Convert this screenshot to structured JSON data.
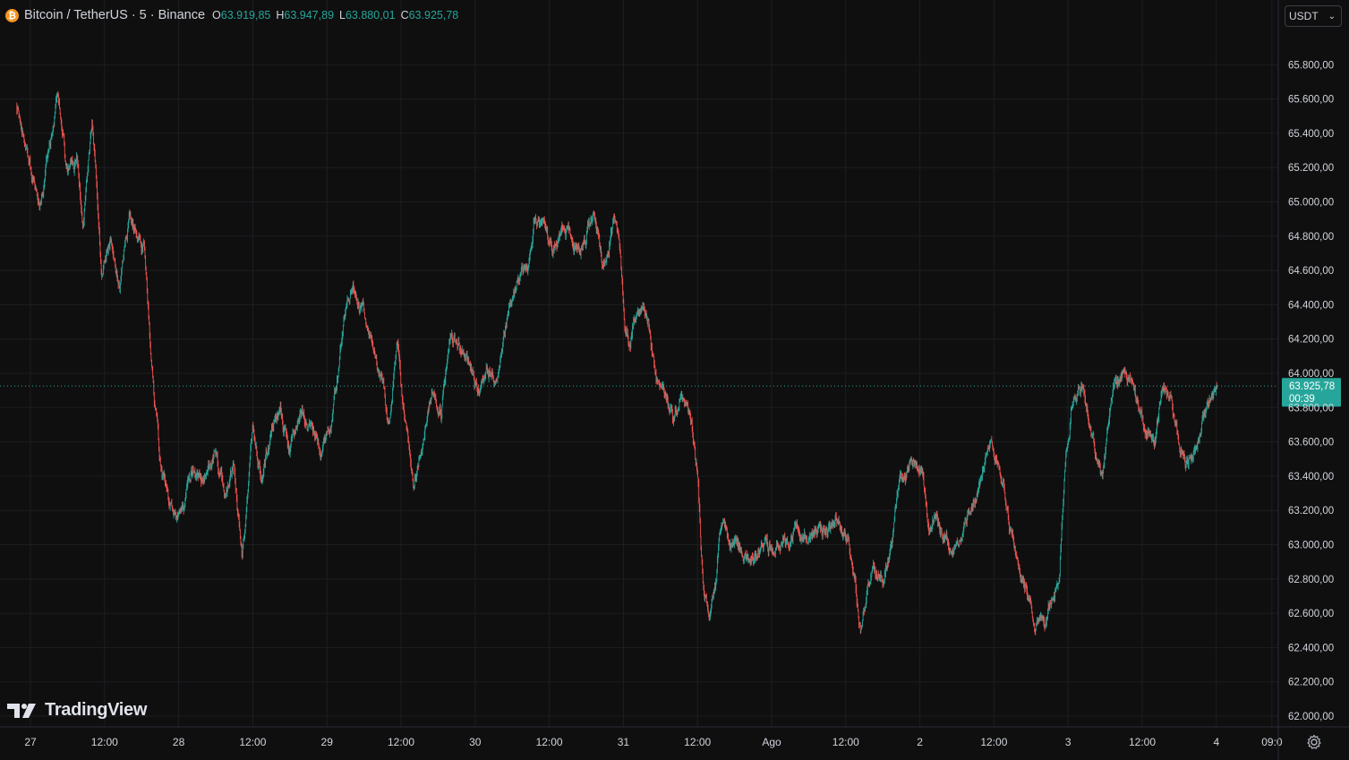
{
  "legend": {
    "symbol": "Bitcoin / TetherUS · 5 · Binance",
    "icon": "bitcoin-icon",
    "open_label": "O",
    "open_value": "63.919,85",
    "high_label": "H",
    "high_value": "63.947,89",
    "low_label": "L",
    "low_value": "63.880,01",
    "close_label": "C",
    "close_value": "63.925,78"
  },
  "currency": {
    "label": "USDT"
  },
  "branding": {
    "name": "TradingView"
  },
  "price_tag": {
    "price": "63.925,78",
    "countdown": "00:39"
  },
  "colors": {
    "background": "#0f0f0f",
    "up": "#26a69a",
    "down": "#ef5350",
    "grid": "#1c1e22",
    "axis_text": "#d1d4dc"
  },
  "chart_data": {
    "type": "candlestick",
    "timeframe": "5",
    "exchange": "Binance",
    "ylim": [
      62000,
      66000
    ],
    "y_ticks": [
      "62.000,00",
      "62.200,00",
      "62.400,00",
      "62.600,00",
      "62.800,00",
      "63.000,00",
      "63.200,00",
      "63.400,00",
      "63.600,00",
      "63.800,00",
      "64.000,00",
      "64.200,00",
      "64.400,00",
      "64.600,00",
      "64.800,00",
      "65.000,00",
      "65.200,00",
      "65.400,00",
      "65.600,00",
      "65.800,00"
    ],
    "y_tick_values": [
      62000,
      62200,
      62400,
      62600,
      62800,
      63000,
      63200,
      63400,
      63600,
      63800,
      64000,
      64200,
      64400,
      64600,
      64800,
      65000,
      65200,
      65400,
      65600,
      65800
    ],
    "x_ticks": [
      "27",
      "12:00",
      "28",
      "12:00",
      "29",
      "12:00",
      "30",
      "12:00",
      "31",
      "12:00",
      "Ago",
      "12:00",
      "2",
      "12:00",
      "3",
      "12:00",
      "4",
      "09:0"
    ],
    "x_tick_hours": [
      0,
      12,
      24,
      36,
      48,
      60,
      72,
      84,
      96,
      108,
      120,
      132,
      144,
      156,
      168,
      180,
      192,
      201
    ],
    "last_price": 63925.78,
    "price_path": [
      [
        -2.2,
        65560
      ],
      [
        0.2,
        65150
      ],
      [
        1.5,
        64920
      ],
      [
        3.0,
        65300
      ],
      [
        4.5,
        65620
      ],
      [
        6.0,
        65160
      ],
      [
        7.5,
        65250
      ],
      [
        8.5,
        64850
      ],
      [
        10.0,
        65500
      ],
      [
        11.5,
        64620
      ],
      [
        13.0,
        64760
      ],
      [
        14.5,
        64500
      ],
      [
        16.0,
        64900
      ],
      [
        17.0,
        64850
      ],
      [
        18.5,
        64750
      ],
      [
        20.0,
        63850
      ],
      [
        21.0,
        63500
      ],
      [
        22.0,
        63300
      ],
      [
        24.0,
        63100
      ],
      [
        26.0,
        63450
      ],
      [
        28.0,
        63350
      ],
      [
        30.0,
        63500
      ],
      [
        31.5,
        63280
      ],
      [
        33.0,
        63450
      ],
      [
        34.3,
        62900
      ],
      [
        36.0,
        63700
      ],
      [
        37.5,
        63350
      ],
      [
        39.0,
        63650
      ],
      [
        40.5,
        63800
      ],
      [
        42.0,
        63550
      ],
      [
        44.0,
        63750
      ],
      [
        45.5,
        63650
      ],
      [
        47.0,
        63550
      ],
      [
        48.5,
        63650
      ],
      [
        49.5,
        63900
      ],
      [
        50.5,
        64250
      ],
      [
        52.0,
        64550
      ],
      [
        53.0,
        64450
      ],
      [
        54.5,
        64300
      ],
      [
        55.5,
        64100
      ],
      [
        57.0,
        63950
      ],
      [
        58.0,
        63700
      ],
      [
        59.5,
        64200
      ],
      [
        60.5,
        63750
      ],
      [
        62.0,
        63400
      ],
      [
        63.0,
        63550
      ],
      [
        64.0,
        63700
      ],
      [
        65.0,
        63900
      ],
      [
        66.5,
        63750
      ],
      [
        68.0,
        64250
      ],
      [
        69.5,
        64150
      ],
      [
        71.0,
        64050
      ],
      [
        72.5,
        63900
      ],
      [
        74.0,
        64000
      ],
      [
        75.0,
        63950
      ],
      [
        76.0,
        64050
      ],
      [
        77.5,
        64350
      ],
      [
        79.0,
        64550
      ],
      [
        80.5,
        64600
      ],
      [
        81.5,
        64900
      ],
      [
        83.0,
        64800
      ],
      [
        84.5,
        64700
      ],
      [
        86.0,
        64800
      ],
      [
        87.0,
        64850
      ],
      [
        88.5,
        64700
      ],
      [
        90.0,
        64800
      ],
      [
        91.0,
        64950
      ],
      [
        92.5,
        64700
      ],
      [
        93.5,
        64750
      ],
      [
        94.5,
        64900
      ],
      [
        95.5,
        64650
      ],
      [
        96.2,
        64300
      ],
      [
        97.0,
        64200
      ],
      [
        98.5,
        64400
      ],
      [
        100.0,
        64300
      ],
      [
        101.0,
        64000
      ],
      [
        102.5,
        63900
      ],
      [
        104.0,
        63700
      ],
      [
        105.5,
        63850
      ],
      [
        107.0,
        63700
      ],
      [
        108.0,
        63400
      ],
      [
        109.0,
        62700
      ],
      [
        110.0,
        62600
      ],
      [
        111.0,
        62800
      ],
      [
        112.0,
        63200
      ],
      [
        113.0,
        63000
      ],
      [
        114.5,
        63000
      ],
      [
        116.0,
        62900
      ],
      [
        117.5,
        62950
      ],
      [
        119.0,
        63000
      ],
      [
        120.5,
        62950
      ],
      [
        122.0,
        63050
      ],
      [
        123.5,
        63100
      ],
      [
        125.0,
        63050
      ],
      [
        126.5,
        63050
      ],
      [
        128.0,
        63050
      ],
      [
        129.5,
        63100
      ],
      [
        131.0,
        63100
      ],
      [
        132.5,
        63000
      ],
      [
        133.5,
        62800
      ],
      [
        134.5,
        62500
      ],
      [
        135.5,
        62700
      ],
      [
        136.5,
        62850
      ],
      [
        138.0,
        62850
      ],
      [
        139.5,
        63000
      ],
      [
        140.5,
        63300
      ],
      [
        141.5,
        63450
      ],
      [
        143.0,
        63500
      ],
      [
        144.5,
        63400
      ],
      [
        145.5,
        63050
      ],
      [
        146.5,
        63150
      ],
      [
        148.0,
        63050
      ],
      [
        149.5,
        62950
      ],
      [
        151.0,
        63100
      ],
      [
        152.5,
        63250
      ],
      [
        154.0,
        63400
      ],
      [
        155.5,
        63550
      ],
      [
        156.5,
        63500
      ],
      [
        157.5,
        63400
      ],
      [
        158.5,
        63100
      ],
      [
        159.5,
        63000
      ],
      [
        160.5,
        62800
      ],
      [
        161.5,
        62700
      ],
      [
        162.5,
        62500
      ],
      [
        163.5,
        62550
      ],
      [
        164.5,
        62550
      ],
      [
        165.5,
        62700
      ],
      [
        166.5,
        62800
      ],
      [
        167.5,
        63500
      ],
      [
        168.5,
        63800
      ],
      [
        169.5,
        63850
      ],
      [
        170.5,
        63900
      ],
      [
        171.5,
        63700
      ],
      [
        172.5,
        63500
      ],
      [
        173.5,
        63400
      ],
      [
        174.5,
        63700
      ],
      [
        175.5,
        63900
      ],
      [
        177.0,
        64000
      ],
      [
        178.0,
        63950
      ],
      [
        179.0,
        63800
      ],
      [
        180.0,
        63700
      ],
      [
        181.0,
        63650
      ],
      [
        182.0,
        63600
      ],
      [
        183.0,
        63850
      ],
      [
        184.0,
        63900
      ],
      [
        185.0,
        63750
      ],
      [
        186.0,
        63600
      ],
      [
        187.0,
        63500
      ],
      [
        188.0,
        63500
      ],
      [
        189.0,
        63600
      ],
      [
        190.0,
        63750
      ],
      [
        191.0,
        63850
      ],
      [
        192.2,
        63925.78
      ]
    ]
  }
}
